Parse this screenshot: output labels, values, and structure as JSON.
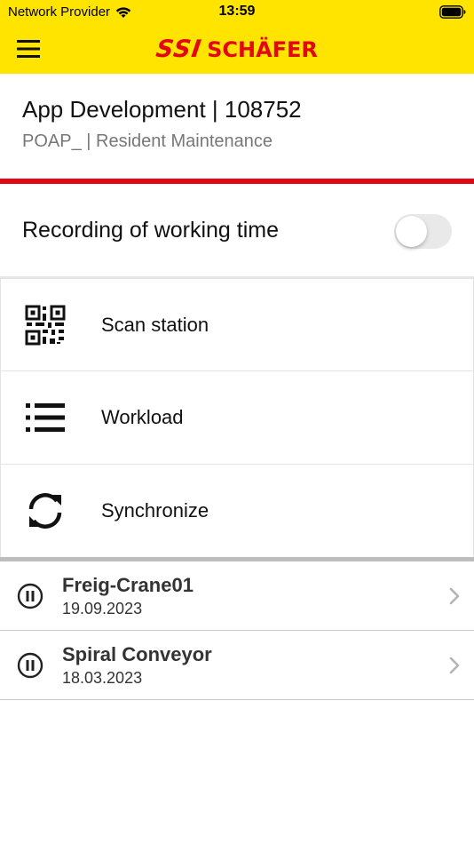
{
  "status_bar": {
    "carrier": "Network Provider",
    "time": "13:59"
  },
  "header": {
    "logo_ssi": "SSI",
    "logo_schafer": "SCHÄFER",
    "brand_color": "#e30613",
    "bar_color": "#ffe400"
  },
  "project": {
    "title": "App Development | 108752",
    "subtitle": "POAP_ | Resident Maintenance"
  },
  "recording": {
    "label": "Recording of working time",
    "enabled": false
  },
  "actions": [
    {
      "label": "Scan station",
      "icon": "qr-code-icon"
    },
    {
      "label": "Workload",
      "icon": "list-icon"
    },
    {
      "label": "Synchronize",
      "icon": "sync-icon"
    }
  ],
  "history": [
    {
      "name": "Freig-Crane01",
      "date": "19.09.2023",
      "icon": "pause-circle-icon"
    },
    {
      "name": "Spiral Conveyor",
      "date": "18.03.2023",
      "icon": "pause-circle-icon"
    }
  ]
}
